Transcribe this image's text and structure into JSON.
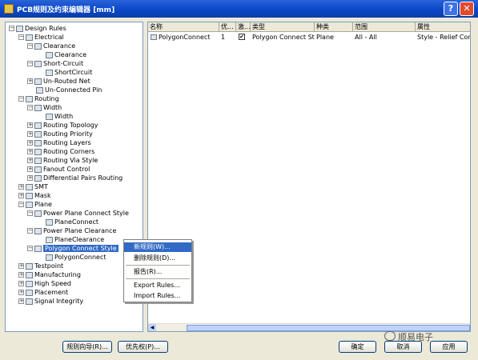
{
  "window": {
    "title": "PCB规则及约束编辑器 [mm]",
    "help_label": "?",
    "close_label": "✕"
  },
  "tree": [
    "Design Rules",
    "Electrical",
    "Clearance",
    "Clearance",
    "Short-Circuit",
    "ShortCircuit",
    "Un-Routed Net",
    "Un-Connected Pin",
    "Routing",
    "Width",
    "Width",
    "Routing Topology",
    "Routing Priority",
    "Routing Layers",
    "Routing Corners",
    "Routing Via Style",
    "Fanout Control",
    "Differential Pairs Routing",
    "SMT",
    "Mask",
    "Plane",
    "Power Plane Connect Style",
    "PlaneConnect",
    "Power Plane Clearance",
    "PlaneClearance",
    "Polygon Connect Style",
    "PolygonConnect",
    "Testpoint",
    "Manufacturing",
    "High Speed",
    "Placement",
    "Signal Integrity"
  ],
  "table": {
    "headers": [
      "名称",
      "优...",
      "激...",
      "类型",
      "种类",
      "范围",
      "属性"
    ],
    "row": {
      "name": "PolygonConnect",
      "priority": "1",
      "enabled": "✔",
      "type": "Polygon Connect Style",
      "kind": "Plane",
      "scope": "All  -  All",
      "attributes": "Style - Relief Connect"
    }
  },
  "context_menu": {
    "new_rule": "新规则(W)...",
    "delete_rule": "删除规则(D)...",
    "report": "报告(R)...",
    "export_rules": "Export Rules...",
    "import_rules": "Import Rules..."
  },
  "buttons": {
    "rule_wizard": "规则向导(R)...",
    "priorities": "优先权(P)...",
    "ok": "确定",
    "cancel": "取消",
    "apply": "应用"
  },
  "watermark": "顺易电子"
}
